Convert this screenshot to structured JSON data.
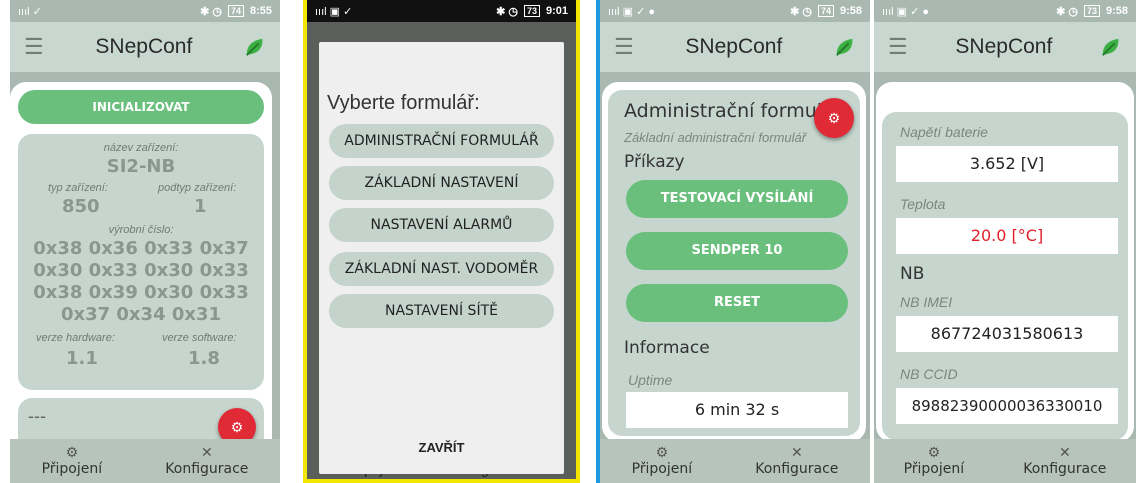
{
  "status1": {
    "time": "8:55",
    "battery": "74"
  },
  "status2": {
    "time": "9:01",
    "battery": "73"
  },
  "status3": {
    "time": "9:58",
    "battery": "74"
  },
  "status4": {
    "time": "9:58",
    "battery": "73"
  },
  "app_title": "SNepConf",
  "bottom_nav": {
    "connect": "Připojení",
    "config": "Konfigurace"
  },
  "screen1": {
    "init_button": "INICIALIZOVAT",
    "device_name_label": "název zařízení:",
    "device_name": "SI2-NB",
    "type_label": "typ zařízení:",
    "type_value": "850",
    "subtype_label": "podtyp zařízení:",
    "subtype_value": "1",
    "serial_label": "výrobní číslo:",
    "serial_lines": [
      "0x38 0x36 0x33 0x37",
      "0x30 0x33 0x30 0x33",
      "0x38 0x39 0x30 0x33",
      "0x37 0x34 0x31"
    ],
    "hw_label": "verze hardware:",
    "hw_value": "1.1",
    "sw_label": "verze software:",
    "sw_value": "1.8",
    "placeholder": "---"
  },
  "screen2": {
    "title": "Vyberte formulář:",
    "options": [
      "ADMINISTRAČNÍ FORMULÁŘ",
      "ZÁKLADNÍ NASTAVENÍ",
      "NASTAVENÍ ALARMŮ",
      "ZÁKLADNÍ NAST. VODOMĚR",
      "NASTAVENÍ SÍTĚ"
    ],
    "close": "ZAVŘÍT"
  },
  "screen3": {
    "title": "Administrační formulář",
    "subtitle": "Základní administrační formulář",
    "commands": "Příkazy",
    "buttons": [
      "TESTOVACÍ VYSÍLÁNÍ",
      "SENDPER 10",
      "RESET"
    ],
    "info": "Informace",
    "uptime_label": "Uptime",
    "uptime_value": "6 min 32 s"
  },
  "screen4": {
    "battery_label": "Napětí baterie",
    "battery_value": "3.652 [V]",
    "temp_label": "Teplota",
    "temp_value": "20.0 [°C]",
    "nb_header": "NB",
    "imei_label": "NB IMEI",
    "imei_value": "867724031580613",
    "ccid_label": "NB CCID",
    "ccid_value": "89882390000036330010"
  },
  "colors": {
    "accent_green": "#6abf7c",
    "fab_red": "#e02a35",
    "temp_red": "#e0202a",
    "frame_yellow": "#f2e600",
    "frame_blue": "#1e9be0"
  }
}
